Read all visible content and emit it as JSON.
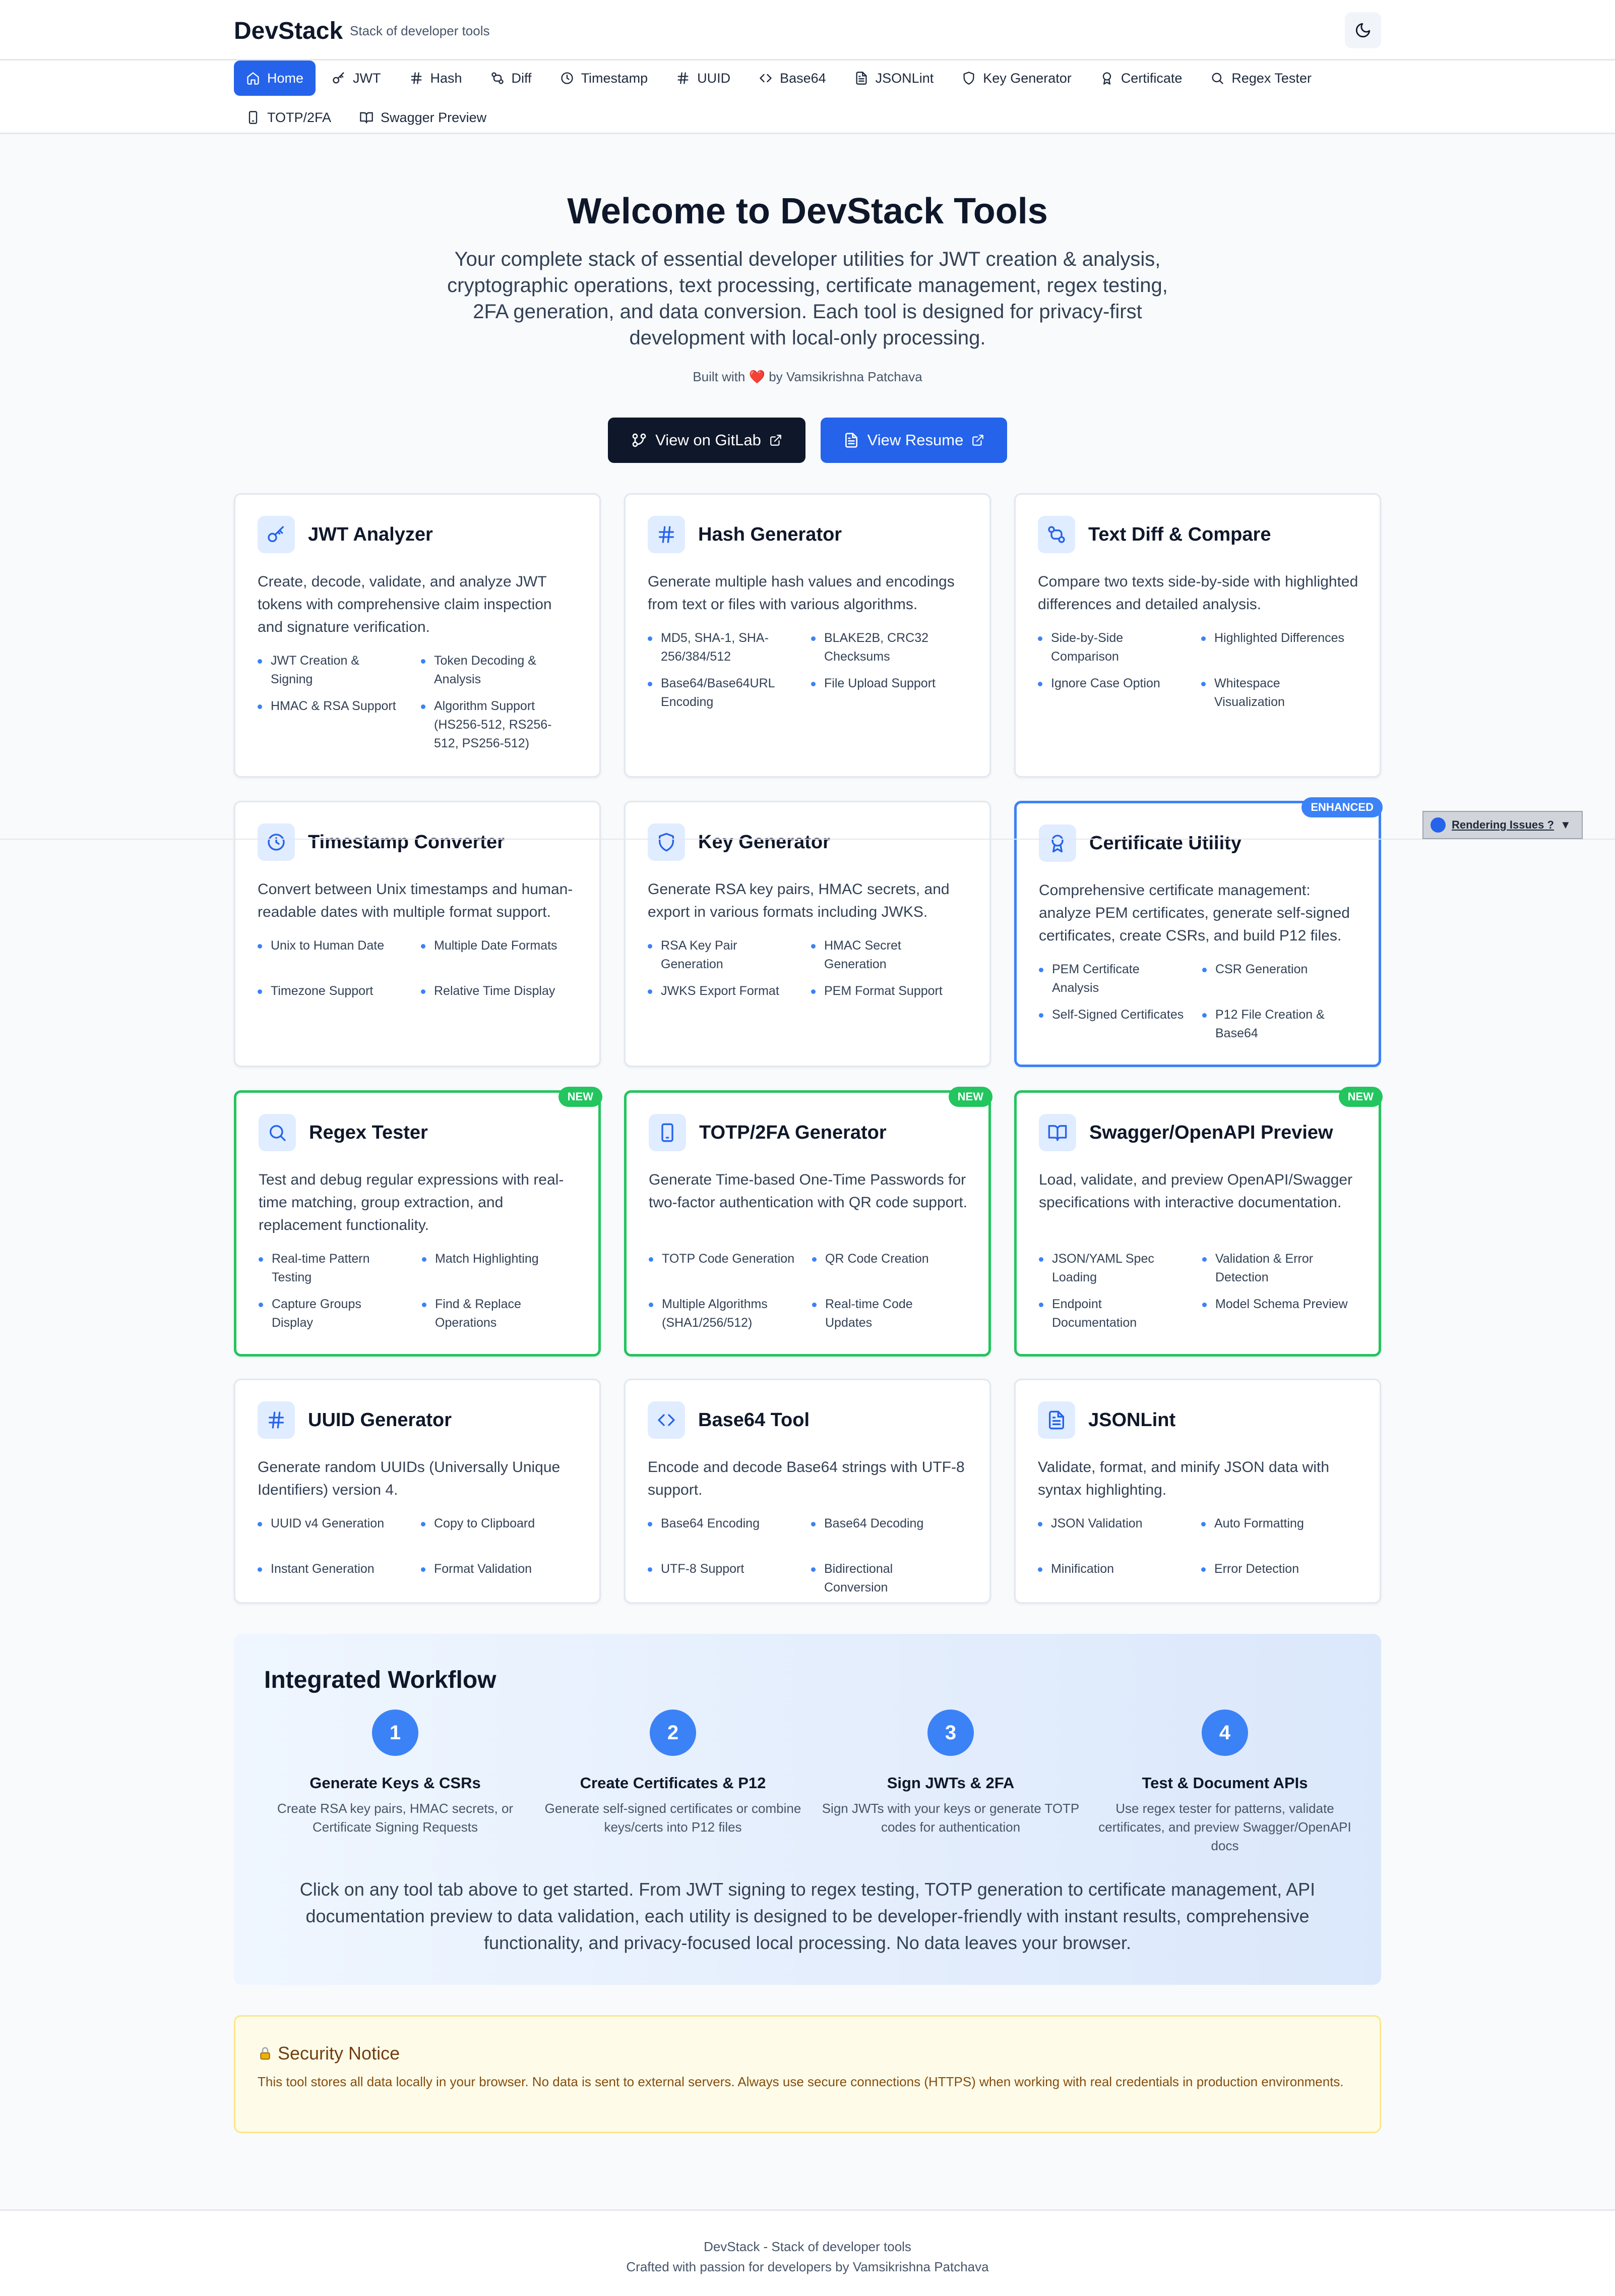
{
  "header": {
    "brand": "DevStack",
    "tagline": "Stack of developer tools",
    "theme_icon": "moon-icon"
  },
  "nav": {
    "tabs": [
      {
        "label": "Home",
        "icon": "home-icon",
        "active": true
      },
      {
        "label": "JWT",
        "icon": "key-icon"
      },
      {
        "label": "Hash",
        "icon": "hash-icon"
      },
      {
        "label": "Diff",
        "icon": "diff-icon"
      },
      {
        "label": "Timestamp",
        "icon": "clock-icon"
      },
      {
        "label": "UUID",
        "icon": "hash-icon"
      },
      {
        "label": "Base64",
        "icon": "code-icon"
      },
      {
        "label": "JSONLint",
        "icon": "file-text-icon"
      },
      {
        "label": "Key Generator",
        "icon": "shield-icon"
      },
      {
        "label": "Certificate",
        "icon": "award-icon"
      },
      {
        "label": "Regex Tester",
        "icon": "search-icon"
      },
      {
        "label": "TOTP/2FA",
        "icon": "smartphone-icon"
      },
      {
        "label": "Swagger Preview",
        "icon": "book-open-icon"
      }
    ]
  },
  "hero": {
    "title": "Welcome to DevStack Tools",
    "description": "Your complete stack of essential developer utilities for JWT creation & analysis, cryptographic operations, text processing, certificate management, regex testing, 2FA generation, and data conversion. Each tool is designed for privacy-first development with local-only processing.",
    "built_prefix": "Built with",
    "built_suffix": "by Vamsikrishna Patchava",
    "gitlab_button": "View on GitLab",
    "resume_button": "View Resume"
  },
  "cards": [
    {
      "title": "JWT Analyzer",
      "icon": "key-icon",
      "badge": "",
      "description": "Create, decode, validate, and analyze JWT tokens with comprehensive claim inspection and signature verification.",
      "features": [
        "JWT Creation & Signing",
        "Token Decoding & Analysis",
        "HMAC & RSA Support",
        "Algorithm Support (HS256-512, RS256-512, PS256-512)"
      ]
    },
    {
      "title": "Hash Generator",
      "icon": "hash-icon",
      "badge": "",
      "description": "Generate multiple hash values and encodings from text or files with various algorithms.",
      "features": [
        "MD5, SHA-1, SHA-256/384/512",
        "BLAKE2B, CRC32 Checksums",
        "Base64/Base64URL Encoding",
        "File Upload Support"
      ]
    },
    {
      "title": "Text Diff & Compare",
      "icon": "diff-icon",
      "badge": "",
      "description": "Compare two texts side-by-side with highlighted differences and detailed analysis.",
      "features": [
        "Side-by-Side Comparison",
        "Highlighted Differences",
        "Ignore Case Option",
        "Whitespace Visualization"
      ]
    },
    {
      "title": "Timestamp Converter",
      "icon": "clock-icon",
      "badge": "",
      "description": "Convert between Unix timestamps and human-readable dates with multiple format support.",
      "features": [
        "Unix to Human Date",
        "Multiple Date Formats",
        "Timezone Support",
        "Relative Time Display"
      ]
    },
    {
      "title": "Key Generator",
      "icon": "shield-icon",
      "badge": "",
      "description": "Generate RSA key pairs, HMAC secrets, and export in various formats including JWKS.",
      "features": [
        "RSA Key Pair Generation",
        "HMAC Secret Generation",
        "JWKS Export Format",
        "PEM Format Support"
      ]
    },
    {
      "title": "Certificate Utility",
      "icon": "award-icon",
      "badge": "ENHANCED",
      "description": "Comprehensive certificate management: analyze PEM certificates, generate self-signed certificates, create CSRs, and build P12 files.",
      "features": [
        "PEM Certificate Analysis",
        "CSR Generation",
        "Self-Signed Certificates",
        "P12 File Creation & Base64"
      ]
    },
    {
      "title": "Regex Tester",
      "icon": "search-icon",
      "badge": "NEW",
      "description": "Test and debug regular expressions with real-time matching, group extraction, and replacement functionality.",
      "features": [
        "Real-time Pattern Testing",
        "Match Highlighting",
        "Capture Groups Display",
        "Find & Replace Operations"
      ]
    },
    {
      "title": "TOTP/2FA Generator",
      "icon": "smartphone-icon",
      "badge": "NEW",
      "description": "Generate Time-based One-Time Passwords for two-factor authentication with QR code support.",
      "features": [
        "TOTP Code Generation",
        "QR Code Creation",
        "Multiple Algorithms (SHA1/256/512)",
        "Real-time Code Updates"
      ]
    },
    {
      "title": "Swagger/OpenAPI Preview",
      "icon": "book-open-icon",
      "badge": "NEW",
      "description": "Load, validate, and preview OpenAPI/Swagger specifications with interactive documentation.",
      "features": [
        "JSON/YAML Spec Loading",
        "Validation & Error Detection",
        "Endpoint Documentation",
        "Model Schema Preview"
      ]
    },
    {
      "title": "UUID Generator",
      "icon": "hash-icon",
      "badge": "",
      "description": "Generate random UUIDs (Universally Unique Identifiers) version 4.",
      "features": [
        "UUID v4 Generation",
        "Copy to Clipboard",
        "Instant Generation",
        "Format Validation"
      ]
    },
    {
      "title": "Base64 Tool",
      "icon": "code-icon",
      "badge": "",
      "description": "Encode and decode Base64 strings with UTF-8 support.",
      "features": [
        "Base64 Encoding",
        "Base64 Decoding",
        "UTF-8 Support",
        "Bidirectional Conversion"
      ]
    },
    {
      "title": "JSONLint",
      "icon": "file-text-icon",
      "badge": "",
      "description": "Validate, format, and minify JSON data with syntax highlighting.",
      "features": [
        "JSON Validation",
        "Auto Formatting",
        "Minification",
        "Error Detection"
      ]
    }
  ],
  "render_widget": {
    "label": "Rendering Issues ?"
  },
  "workflow": {
    "title": "Integrated Workflow",
    "steps": [
      {
        "num": "1",
        "title": "Generate Keys & CSRs",
        "desc": "Create RSA key pairs, HMAC secrets, or Certificate Signing Requests"
      },
      {
        "num": "2",
        "title": "Create Certificates & P12",
        "desc": "Generate self-signed certificates or combine keys/certs into P12 files"
      },
      {
        "num": "3",
        "title": "Sign JWTs & 2FA",
        "desc": "Sign JWTs with your keys or generate TOTP codes for authentication"
      },
      {
        "num": "4",
        "title": "Test & Document APIs",
        "desc": "Use regex tester for patterns, validate certificates, and preview Swagger/OpenAPI docs"
      }
    ],
    "text": "Click on any tool tab above to get started. From JWT signing to regex testing, TOTP generation to certificate management, API documentation preview to data validation, each utility is designed to be developer-friendly with instant results, comprehensive functionality, and privacy-focused local processing. No data leaves your browser."
  },
  "security": {
    "title": "Security Notice",
    "text": "This tool stores all data locally in your browser. No data is sent to external servers. Always use secure connections (HTTPS) when working with real credentials in production environments."
  },
  "footer": {
    "line1": "DevStack - Stack of developer tools",
    "line2": "Crafted with passion for developers by Vamsikrishna Patchava"
  },
  "colors": {
    "accent": "#2563eb",
    "new": "#22c55e",
    "enhanced": "#3b82f6",
    "dark_button": "#0f172a"
  }
}
